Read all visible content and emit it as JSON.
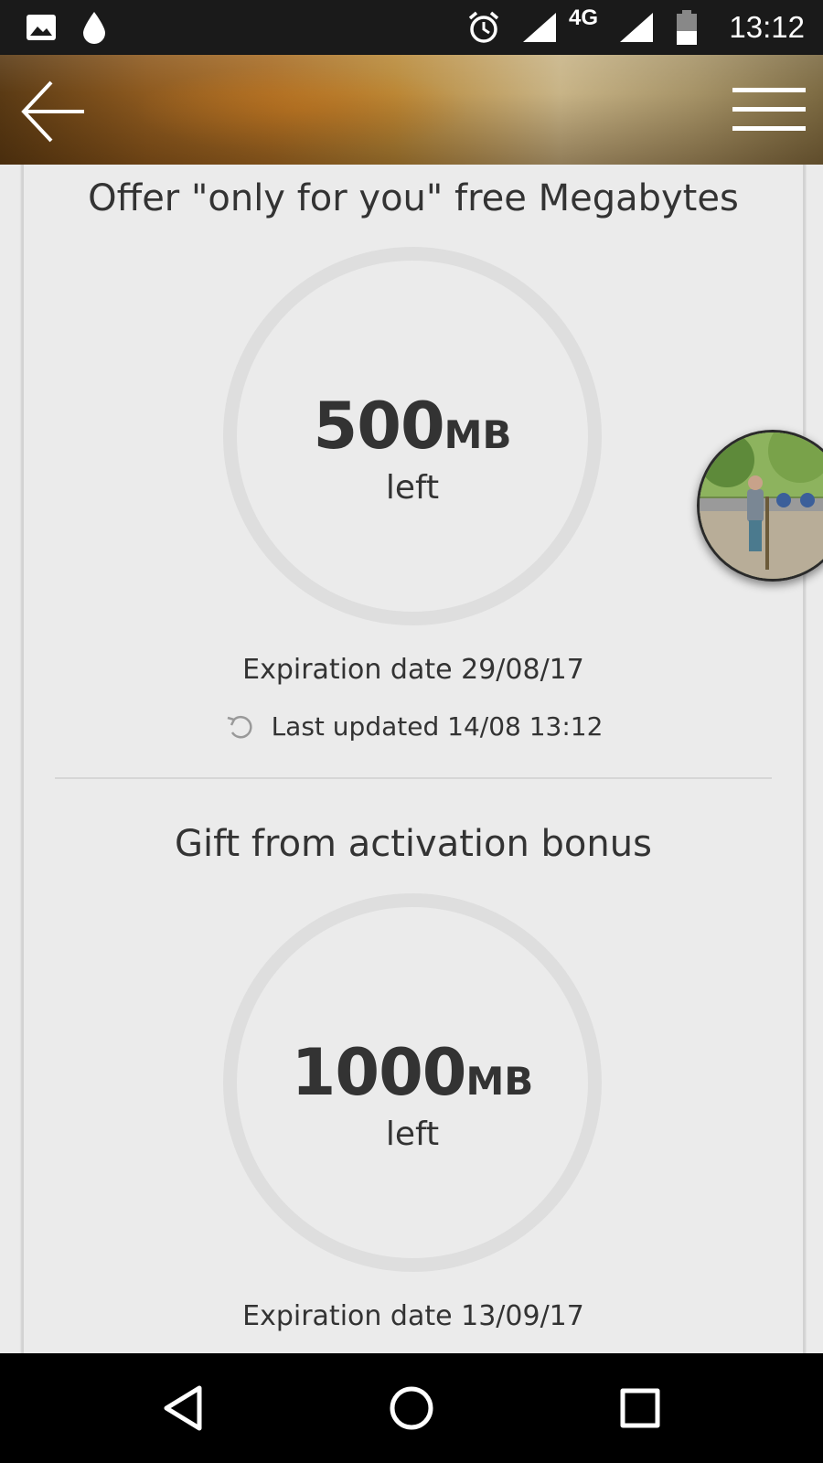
{
  "status_bar": {
    "time": "13:12",
    "network": "4G",
    "icons": [
      "image-icon",
      "water-drop-icon",
      "alarm-icon",
      "signal-icon",
      "signal-icon",
      "battery-icon"
    ]
  },
  "header": {
    "back_icon": "arrow-left-icon",
    "menu_icon": "hamburger-menu-icon"
  },
  "offers": [
    {
      "title": "Offer \"only for you\" free Megabytes",
      "amount": "500",
      "unit": "MB",
      "sub": "left",
      "expiration": "Expiration date 29/08/17",
      "last_updated": "Last updated 14/08 13:12"
    },
    {
      "title": "Gift from activation bonus",
      "amount": "1000",
      "unit": "MB",
      "sub": "left",
      "expiration": "Expiration date 13/09/17"
    }
  ],
  "colors": {
    "background": "#ebebeb",
    "gauge_ring": "#dedede",
    "text": "#333333"
  },
  "nav_bar": {
    "back_icon": "nav-back-icon",
    "home_icon": "nav-home-icon",
    "recents_icon": "nav-recents-icon"
  }
}
